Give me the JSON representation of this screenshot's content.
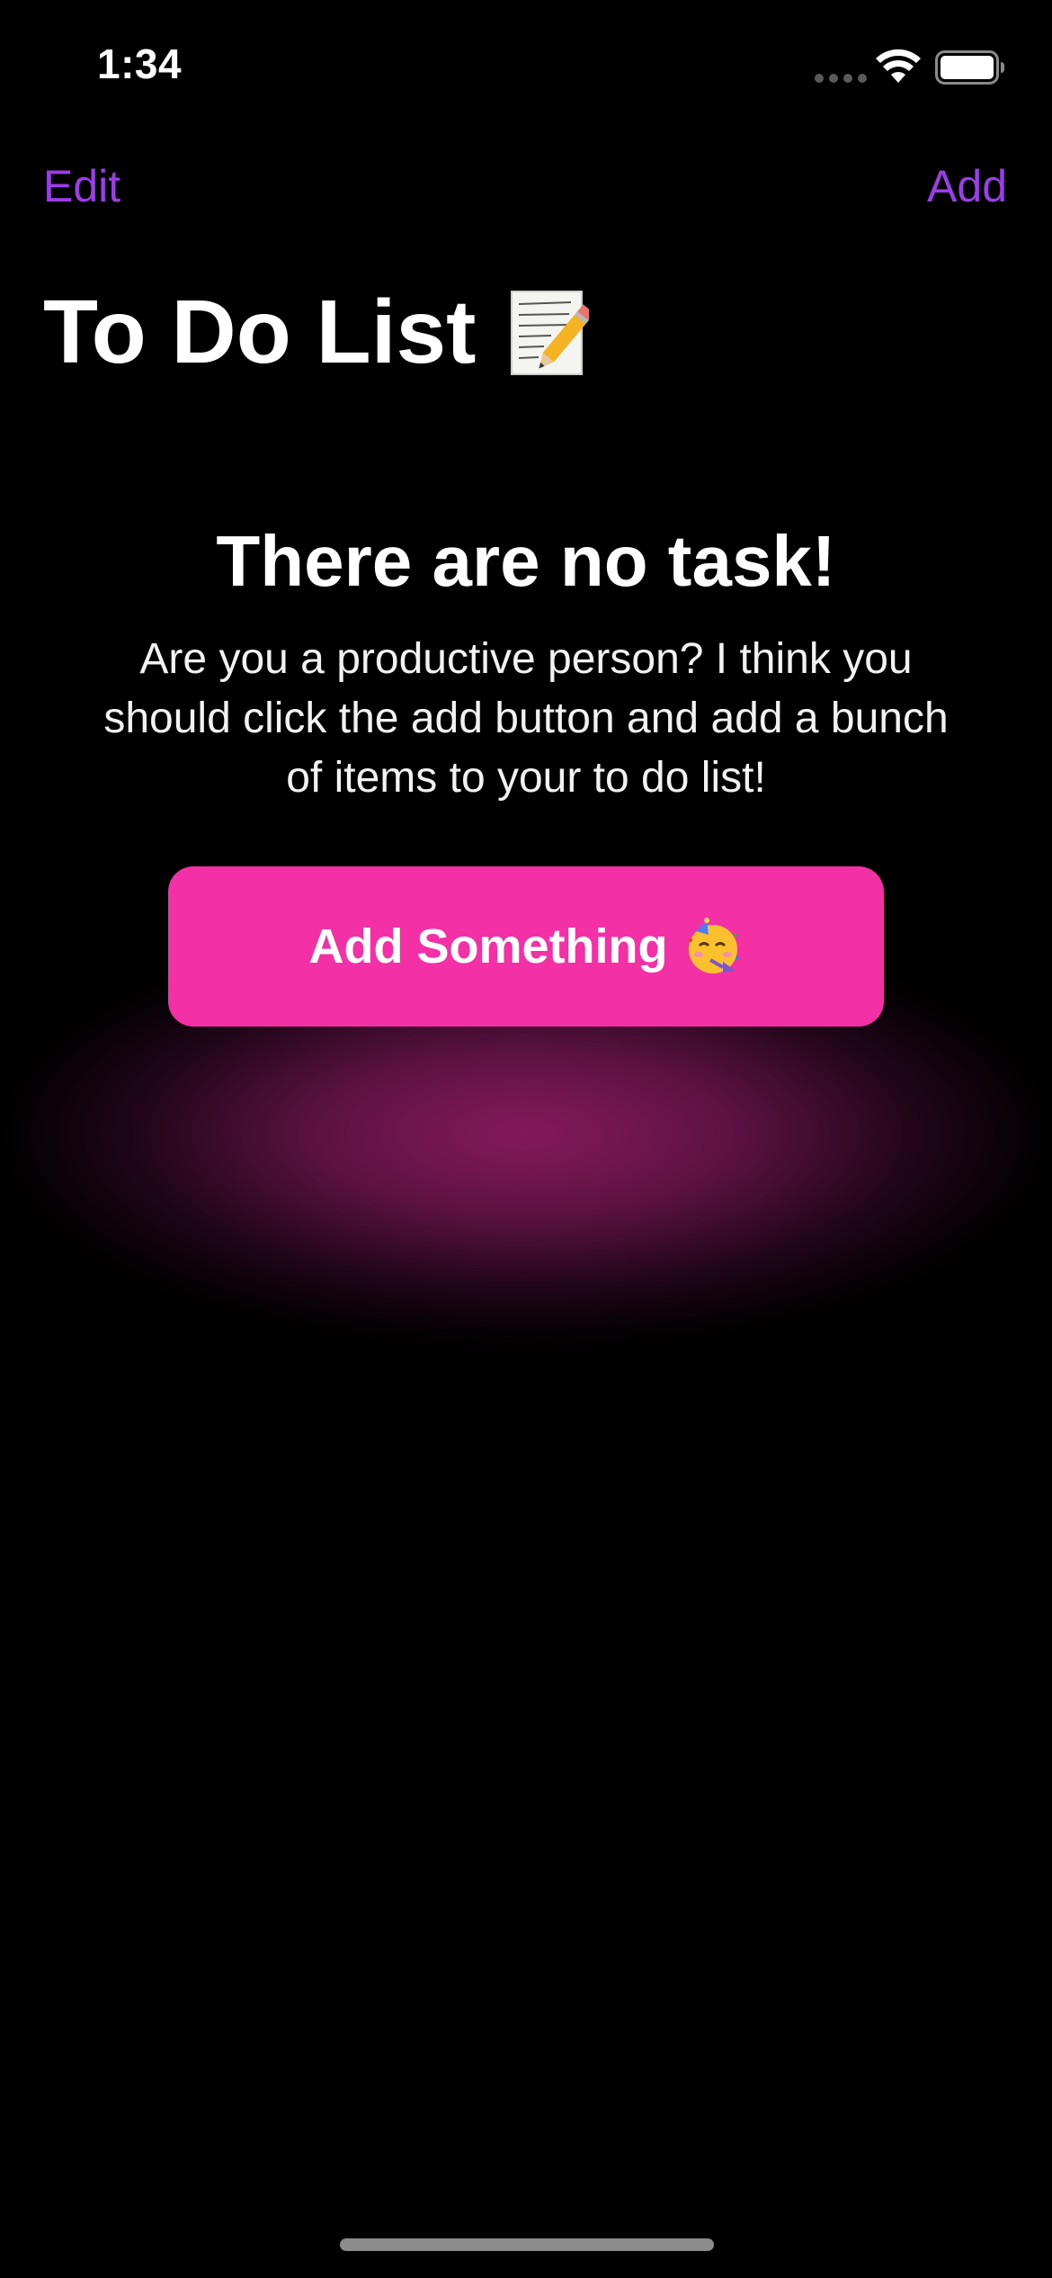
{
  "status_bar": {
    "time": "1:34",
    "icons": [
      "signal-dots-icon",
      "wifi-icon",
      "battery-icon"
    ]
  },
  "nav": {
    "edit_label": "Edit",
    "add_label": "Add"
  },
  "title": {
    "text": "To Do List",
    "icon": "memo-icon"
  },
  "empty_state": {
    "heading": "There are no task!",
    "message": "Are you a productive person? I think you should click the add button and add a bunch of items to your to do list!",
    "button_label": "Add Something",
    "button_icon": "party-face-icon"
  },
  "colors": {
    "accent": "#9b3ee8",
    "button": "#f430a6",
    "background": "#000000",
    "glow": "#a01e6e"
  }
}
